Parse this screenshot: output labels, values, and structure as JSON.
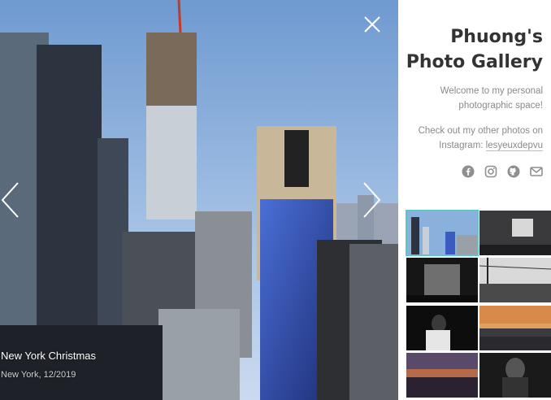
{
  "gallery": {
    "title_line1": "Phuong's",
    "title_line2": "Photo Gallery",
    "intro_line1": "Welcome to my personal",
    "intro_line2": "photographic space!",
    "insta_line1": "Check out my other photos on",
    "insta_prefix": "Instagram: ",
    "insta_handle": "lesyeuxdepvu",
    "social_icons": [
      "facebook-icon",
      "instagram-icon",
      "github-icon",
      "email-icon"
    ]
  },
  "viewer": {
    "caption_title": "New York Christmas",
    "caption_sub": "New York, 12/2019",
    "controls": [
      "close-icon",
      "chevron-left-icon",
      "chevron-right-icon"
    ]
  },
  "thumbnails": {
    "active_index": 0,
    "accent": "#5ac8c8",
    "count": 8
  }
}
